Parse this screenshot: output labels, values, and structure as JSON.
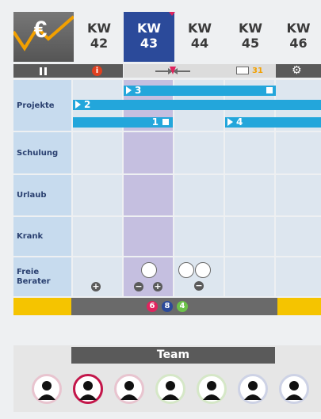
{
  "app": {
    "logo_icon": "euro-trend-icon",
    "logo_symbol": "€"
  },
  "weeks": [
    {
      "label": "KW",
      "number": "42"
    },
    {
      "label": "KW",
      "number": "43"
    },
    {
      "label": "KW",
      "number": "44"
    },
    {
      "label": "KW",
      "number": "45"
    },
    {
      "label": "KW",
      "number": "46"
    }
  ],
  "toolbar": {
    "pause_icon": "pause-icon",
    "info_icon": "info-icon",
    "navigate_icon": "arrows-converge-icon",
    "mail_icon": "mail-icon",
    "calendar_badge": "31",
    "settings_icon": "gear-icon"
  },
  "rows": {
    "projekte": "Projekte",
    "schulung": "Schulung",
    "urlaub": "Urlaub",
    "krank": "Krank",
    "freie_berater": "Freie Berater"
  },
  "projects": [
    {
      "label": "3"
    },
    {
      "label": "2"
    },
    {
      "label": "1"
    },
    {
      "label": "4"
    }
  ],
  "counts": [
    {
      "value": "6",
      "color": "#e0245e"
    },
    {
      "value": "8",
      "color": "#2b4a9a"
    },
    {
      "value": "4",
      "color": "#6cc24a"
    }
  ],
  "team": {
    "title": "Team"
  }
}
